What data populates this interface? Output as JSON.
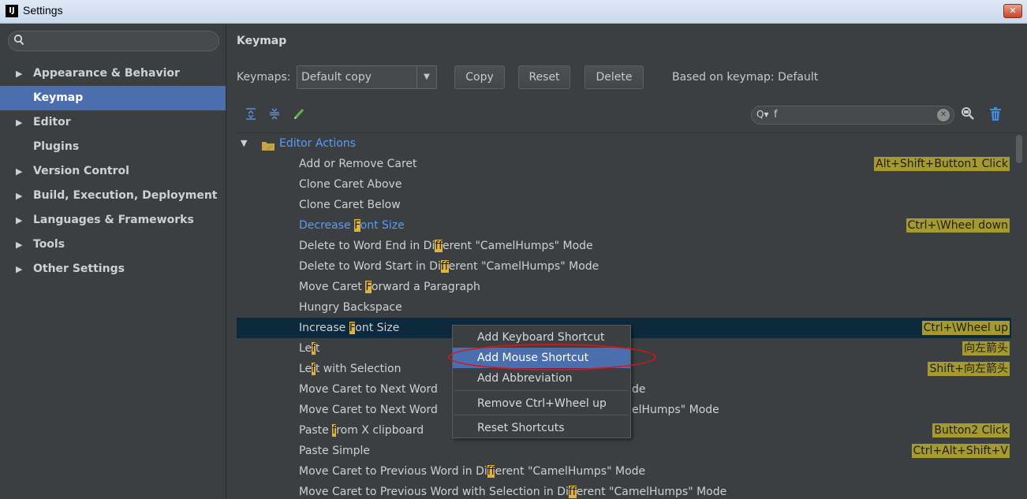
{
  "window": {
    "title": "Settings",
    "app_icon_text": "IJ",
    "close_glyph": "✕"
  },
  "sidebar": {
    "search_placeholder": "",
    "items": [
      {
        "label": "Appearance & Behavior",
        "expandable": true
      },
      {
        "label": "Keymap",
        "expandable": false,
        "selected": true
      },
      {
        "label": "Editor",
        "expandable": true
      },
      {
        "label": "Plugins",
        "expandable": false
      },
      {
        "label": "Version Control",
        "expandable": true
      },
      {
        "label": "Build, Execution, Deployment",
        "expandable": true
      },
      {
        "label": "Languages & Frameworks",
        "expandable": true
      },
      {
        "label": "Tools",
        "expandable": true
      },
      {
        "label": "Other Settings",
        "expandable": true
      }
    ]
  },
  "main": {
    "heading": "Keymap",
    "keymaps_label": "Keymaps:",
    "keymap_selected": "Default copy",
    "buttons": {
      "copy": "Copy",
      "reset": "Reset",
      "delete": "Delete"
    },
    "based_on": "Based on keymap: Default",
    "filter": {
      "value": "f",
      "glass": "Q▾",
      "clear": "✕"
    }
  },
  "tree": {
    "root": {
      "label": "Editor Actions"
    },
    "rows": [
      {
        "pre": "Add or Remove Caret",
        "shortcut": "Alt+Shift+Button1 Click"
      },
      {
        "pre": "Clone Caret Above"
      },
      {
        "pre": "Clone Caret Below"
      },
      {
        "pre": "Decrease ",
        "hl": "F",
        "post": "ont Size",
        "shortcut": "Ctrl+\\Wheel down",
        "blue": true
      },
      {
        "pre": "Delete to Word End in Di",
        "hl": "ff",
        "post": "erent \"CamelHumps\" Mode"
      },
      {
        "pre": "Delete to Word Start in Di",
        "hl": "ff",
        "post": "erent \"CamelHumps\" Mode"
      },
      {
        "pre": "Move Caret ",
        "hl": "F",
        "post": "orward a Paragraph"
      },
      {
        "pre": "Hungry Backspace"
      },
      {
        "pre": "Increase ",
        "hl": "F",
        "post": "ont Size",
        "shortcut": "Ctrl+\\Wheel up",
        "selected": true
      },
      {
        "pre": "Le",
        "hl": "f",
        "post": "t",
        "shortcut": "向左箭头"
      },
      {
        "pre": "Le",
        "hl": "f",
        "post": "t with Selection",
        "shortcut": "Shift+向左箭头"
      },
      {
        "pre": "Move Caret to Next Word",
        "tail": "de"
      },
      {
        "pre": "Move Caret to Next Word",
        "tail": "elHumps\" Mode"
      },
      {
        "pre": "Paste ",
        "hl": "f",
        "post": "rom X clipboard",
        "shortcut": "Button2 Click"
      },
      {
        "pre": "Paste Simple",
        "shortcut": "Ctrl+Alt+Shift+V"
      },
      {
        "pre": "Move Caret to Previous Word in Di",
        "hl": "ff",
        "post": "erent \"CamelHumps\" Mode"
      },
      {
        "pre": "Move Caret to Previous Word with Selection in Di",
        "hl": "ff",
        "post": "erent \"CamelHumps\" Mode"
      }
    ]
  },
  "context_menu": {
    "items": [
      {
        "label": "Add Keyboard Shortcut"
      },
      {
        "label": "Add Mouse Shortcut",
        "active": true
      },
      {
        "label": "Add Abbreviation"
      },
      {
        "label": "Remove Ctrl+Wheel up"
      },
      {
        "label": "Reset Shortcuts"
      }
    ]
  },
  "colors": {
    "background": "#3c3f41",
    "selection": "#4b6eaf",
    "tree_selection": "#0d293e",
    "link_blue": "#589df6",
    "shortcut_badge": "#a59a2f",
    "search_highlight": "#e0b43c",
    "annotation_red": "#d8131a"
  }
}
